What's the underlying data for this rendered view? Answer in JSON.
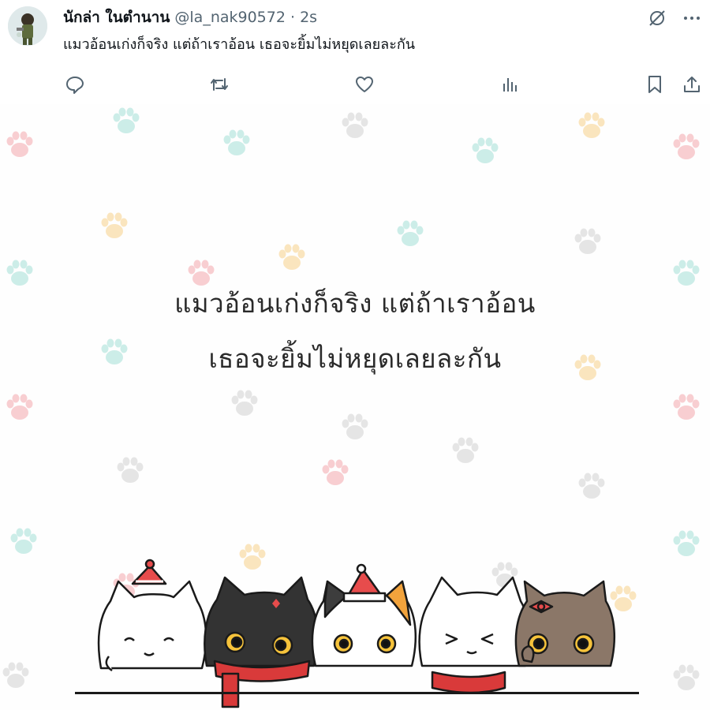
{
  "tweet": {
    "display_name": "นักล่า ในตำนาน",
    "handle": "@la_nak90572",
    "separator": "·",
    "time": "2s",
    "text": "แมวอ้อนเก่งก็จริง แต่ถ้าเราอ้อน เธอจะยิ้มไม่หยุดเลยละกัน"
  },
  "icons": {
    "top": [
      "grok-icon",
      "more-icon"
    ],
    "actions": [
      "reply-icon",
      "retweet-icon",
      "like-icon",
      "views-icon",
      "bookmark-icon",
      "share-icon"
    ]
  },
  "media": {
    "line1": "แมวอ้อนเก่งก็จริง แต่ถ้าเราอ้อน",
    "line2": "เธอจะยิ้มไม่หยุดเลยละกัน"
  },
  "colors": {
    "text": "#0f1419",
    "muted": "#536471",
    "paw_pink": "#f8c9cc",
    "paw_teal": "#c7ebe6",
    "paw_gray": "#e3e3e3",
    "paw_yellow": "#fae2b7"
  }
}
